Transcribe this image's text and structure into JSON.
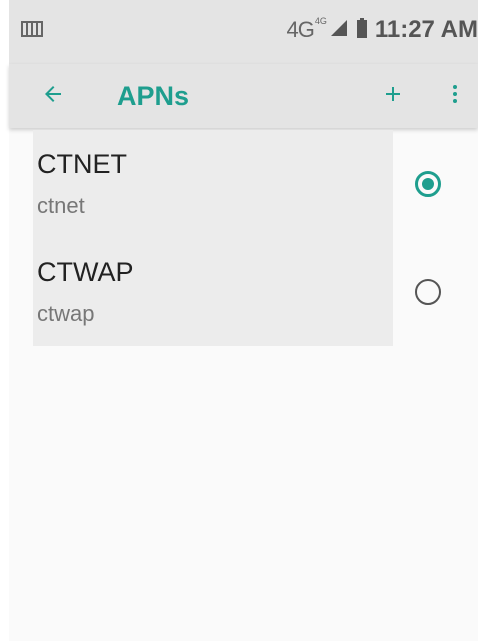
{
  "status_bar": {
    "network": "4G",
    "network_sup": "4G",
    "time": "11:27 AM",
    "icons": [
      "sim-card-icon",
      "signal-icon",
      "battery-icon"
    ]
  },
  "app_bar": {
    "title": "APNs",
    "back_icon": "arrow-left-icon",
    "add_icon": "plus-icon",
    "more_icon": "more-vert-icon"
  },
  "apns": [
    {
      "name": "CTNET",
      "apn": "ctnet",
      "selected": true
    },
    {
      "name": "CTWAP",
      "apn": "ctwap",
      "selected": false
    }
  ],
  "colors": {
    "accent": "#1e9e8e",
    "bar_background": "#e4e4e4",
    "row_background": "#ececec",
    "page_background": "#fafafa"
  }
}
